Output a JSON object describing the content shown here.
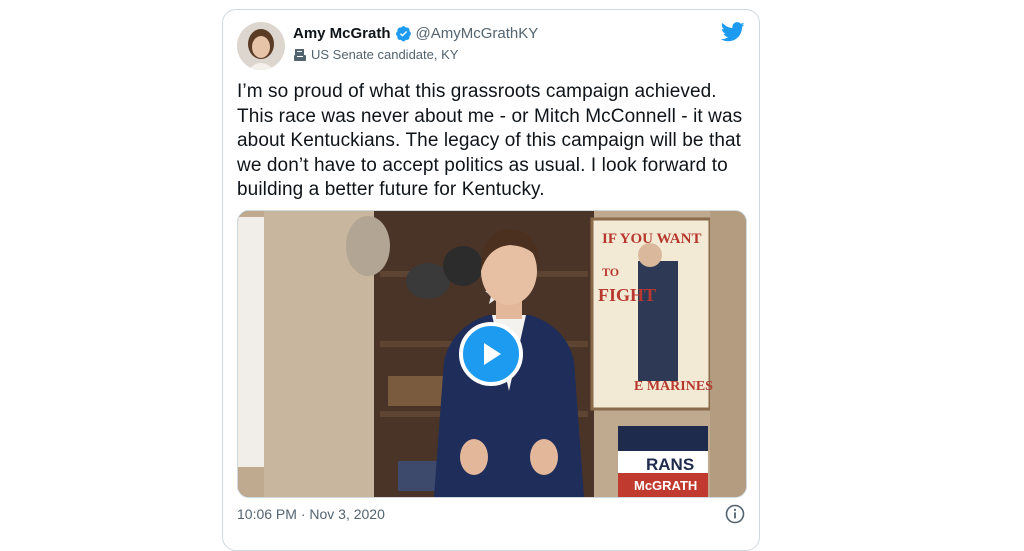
{
  "tweet": {
    "author": {
      "display_name": "Amy McGrath",
      "handle": "@AmyMcGrathKY",
      "label": "US Senate candidate, KY",
      "verified": true
    },
    "text": "I’m so proud of what this grassroots campaign achieved. This race was never about me - or Mitch McConnell - it was about Kentuckians. The legacy of this campaign will be that we don’t have to accept politics as usual. I look forward to building a better future for Kentucky.",
    "timestamp": "10:06 PM · Nov 3, 2020",
    "media": {
      "type": "video",
      "poster_line1": "IF YOU WANT",
      "poster_line2": "TO",
      "poster_line3": "FIGHT",
      "poster_line4": "E MARINES",
      "sign_line1": "RANS",
      "sign_line2": "McGRATH"
    }
  },
  "colors": {
    "accent": "#1d9bf0",
    "text": "#0f1419",
    "muted": "#536471",
    "border": "#cfd9de"
  },
  "icons": {
    "verified": "verified-badge-icon",
    "bio": "ballot-box-icon",
    "brand": "twitter-bird-icon",
    "play": "play-icon",
    "info": "info-icon"
  }
}
